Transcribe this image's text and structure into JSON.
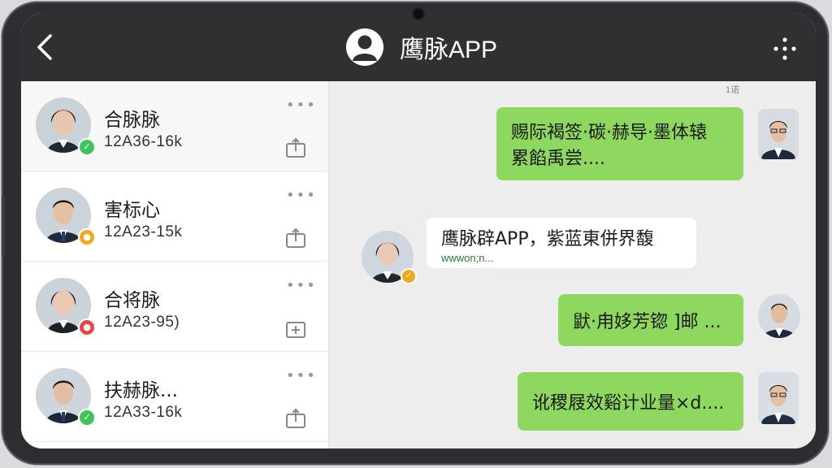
{
  "header": {
    "back_icon": "chevron-left-icon",
    "avatar_icon": "user-avatar-icon",
    "title": "鹰脉APP",
    "more_icon": "more-dots-icon"
  },
  "contacts": [
    {
      "name": "合脉脉",
      "meta": "12A36-16k",
      "status_color": "#3ec45a",
      "action_icon": "upload-icon"
    },
    {
      "name": "害标心",
      "meta": "12A23-15k",
      "status_color": "#f2a81d",
      "action_icon": "upload-icon"
    },
    {
      "name": "合将脉",
      "meta": "12A23-95)",
      "status_color": "#e54848",
      "action_icon": "add-folder-icon"
    },
    {
      "name": "扶赫脉...",
      "meta": "12A33-16k",
      "status_color": "#3ec45a",
      "action_icon": "upload-icon"
    }
  ],
  "contact_more_label": "•••",
  "chat": {
    "counter": "1诺",
    "messages": [
      {
        "direction": "sent",
        "lines": [
          "赐际褐签·碳·赫导·墨体辕",
          "累餡禹尝...."
        ]
      },
      {
        "direction": "received",
        "lines": [
          "鹰脉辟APP，紫蓝東併界馥"
        ],
        "sub": "wwwon;n..."
      },
      {
        "direction": "sent",
        "lines": [
          "鼣·甪姼芳锪 ]邮 ..."
        ]
      },
      {
        "direction": "sent",
        "lines": [
          "讹稷屐效谿计业量×d...."
        ]
      }
    ]
  },
  "colors": {
    "header_bg": "#2f3032",
    "sent_bubble": "#8fd860",
    "online_green": "#3ec45a",
    "away_orange": "#f2a81d",
    "busy_red": "#e54848"
  }
}
